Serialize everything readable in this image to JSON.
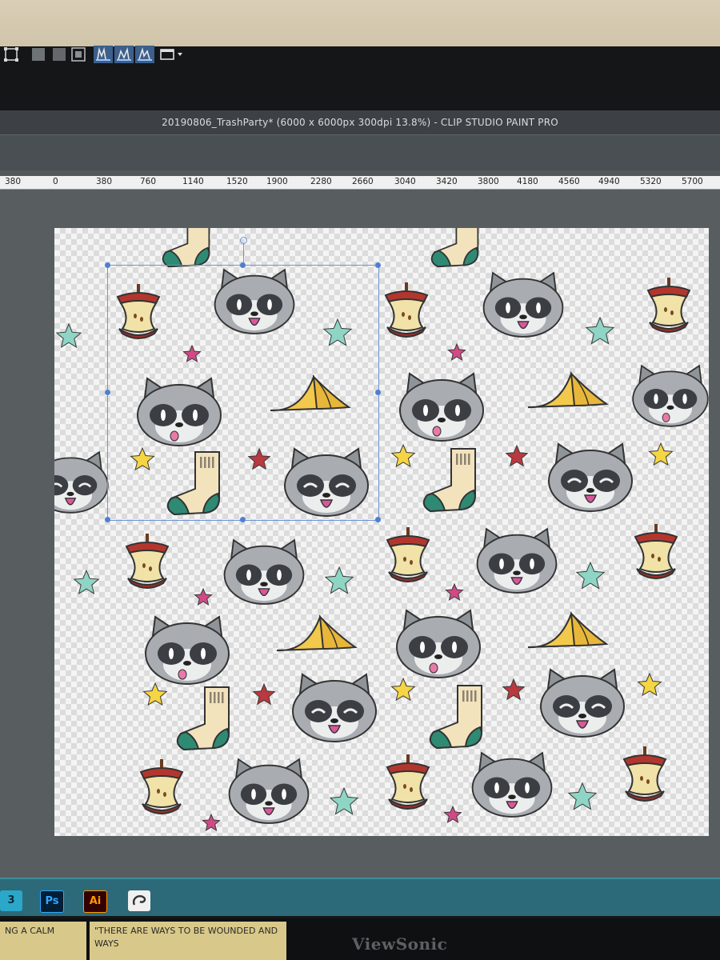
{
  "window": {
    "title": "20190806_TrashParty* (6000 x 6000px 300dpi 13.8%)  - CLIP STUDIO PAINT PRO"
  },
  "toolbar": {
    "icons": [
      "transform-icon",
      "gray-tool-icon",
      "gray-tool-icon-2",
      "layer-icon",
      "pen-pressure-icon-1",
      "pen-pressure-icon-2",
      "pen-pressure-icon-3",
      "window-dropdown-icon"
    ]
  },
  "ruler": {
    "labels": [
      "380",
      "0",
      "380",
      "760",
      "1140",
      "1520",
      "1900",
      "2280",
      "2660",
      "3040",
      "3420",
      "3800",
      "4180",
      "4560",
      "4940",
      "5320",
      "5700"
    ]
  },
  "canvas": {
    "pattern_items": [
      "raccoon-happy",
      "raccoon-surprised",
      "raccoon-tongue",
      "apple-core",
      "banana-peel",
      "sock",
      "star-teal",
      "star-pink",
      "star-yellow",
      "star-red"
    ]
  },
  "taskbar": {
    "apps": [
      {
        "label": "3",
        "icon": "app-3-icon",
        "color": "#2aa7c9"
      },
      {
        "label": "Ps",
        "icon": "photoshop-icon",
        "color": "#31a8ff"
      },
      {
        "label": "Ai",
        "icon": "illustrator-icon",
        "color": "#ff9a00"
      },
      {
        "label": "",
        "icon": "clip-studio-icon",
        "color": "#f0f0f0"
      }
    ]
  },
  "monitor": {
    "brand": "ViewSonic"
  },
  "notes": {
    "left": "NG A CALM",
    "right": "\"THERE ARE WAYS TO BE WOUNDED AND WAYS"
  }
}
